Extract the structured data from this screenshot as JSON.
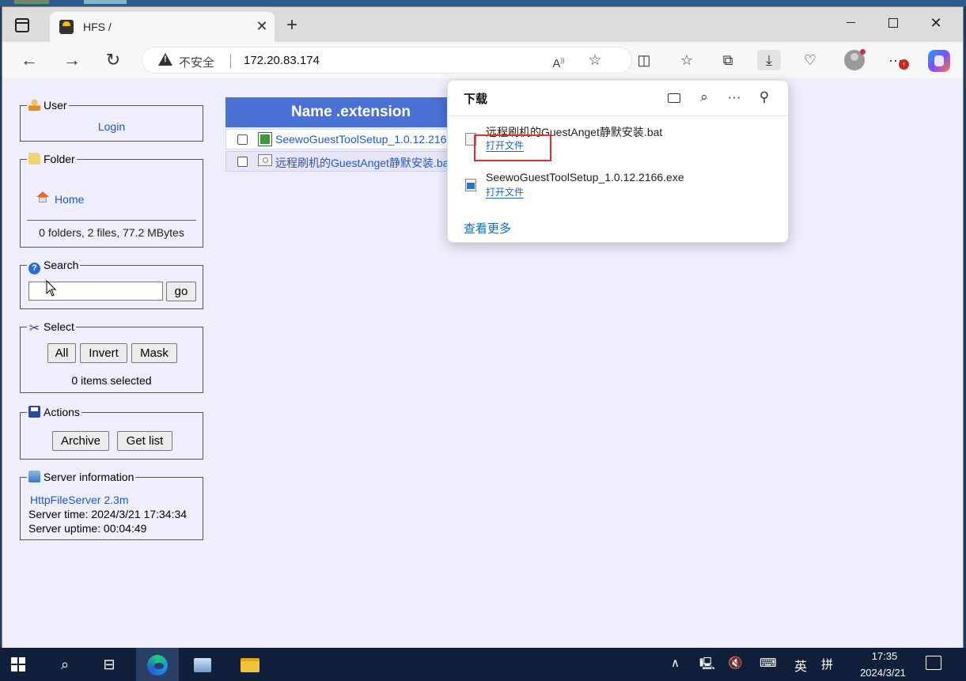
{
  "browser": {
    "tab_title": "HFS /",
    "tab_close": "✕",
    "new_tab": "+",
    "security_label": "不安全",
    "url": "172.20.83.174"
  },
  "window_controls": {
    "close": "✕"
  },
  "hfs": {
    "user": {
      "legend": "User",
      "login": "Login"
    },
    "folder": {
      "legend": "Folder",
      "home": "Home",
      "stats": "0 folders, 2 files, 77.2 MBytes"
    },
    "search": {
      "legend": "Search",
      "go": "go"
    },
    "select": {
      "legend": "Select",
      "all": "All",
      "invert": "Invert",
      "mask": "Mask",
      "status": "0 items selected"
    },
    "actions": {
      "legend": "Actions",
      "archive": "Archive",
      "get_list": "Get list"
    },
    "server": {
      "legend": "Server information",
      "software": "HttpFileServer 2.3m",
      "time": "Server time: 2024/3/21 17:34:34",
      "uptime": "Server uptime: 00:04:49"
    },
    "table": {
      "header": "Name .extension",
      "files": [
        {
          "name": "SeewoGuestToolSetup_1.0.12.2166.exe"
        },
        {
          "name": "远程刷机的GuestAnget静默安装.bat"
        }
      ]
    }
  },
  "downloads": {
    "title": "下载",
    "items": [
      {
        "filename": "远程刷机的GuestAnget静默安装.bat",
        "action": "打开文件"
      },
      {
        "filename": "SeewoGuestToolSetup_1.0.12.2166.exe",
        "action": "打开文件"
      }
    ],
    "see_more": "查看更多"
  },
  "taskbar": {
    "language": "英",
    "ime": "拼",
    "time": "17:35",
    "date": "2024/3/21"
  },
  "colors": {
    "hfs_background": "#eeeefc",
    "hfs_header": "#4a72d4",
    "link": "#2255cc",
    "highlight": "#e03030",
    "taskbar": "#10203a"
  }
}
